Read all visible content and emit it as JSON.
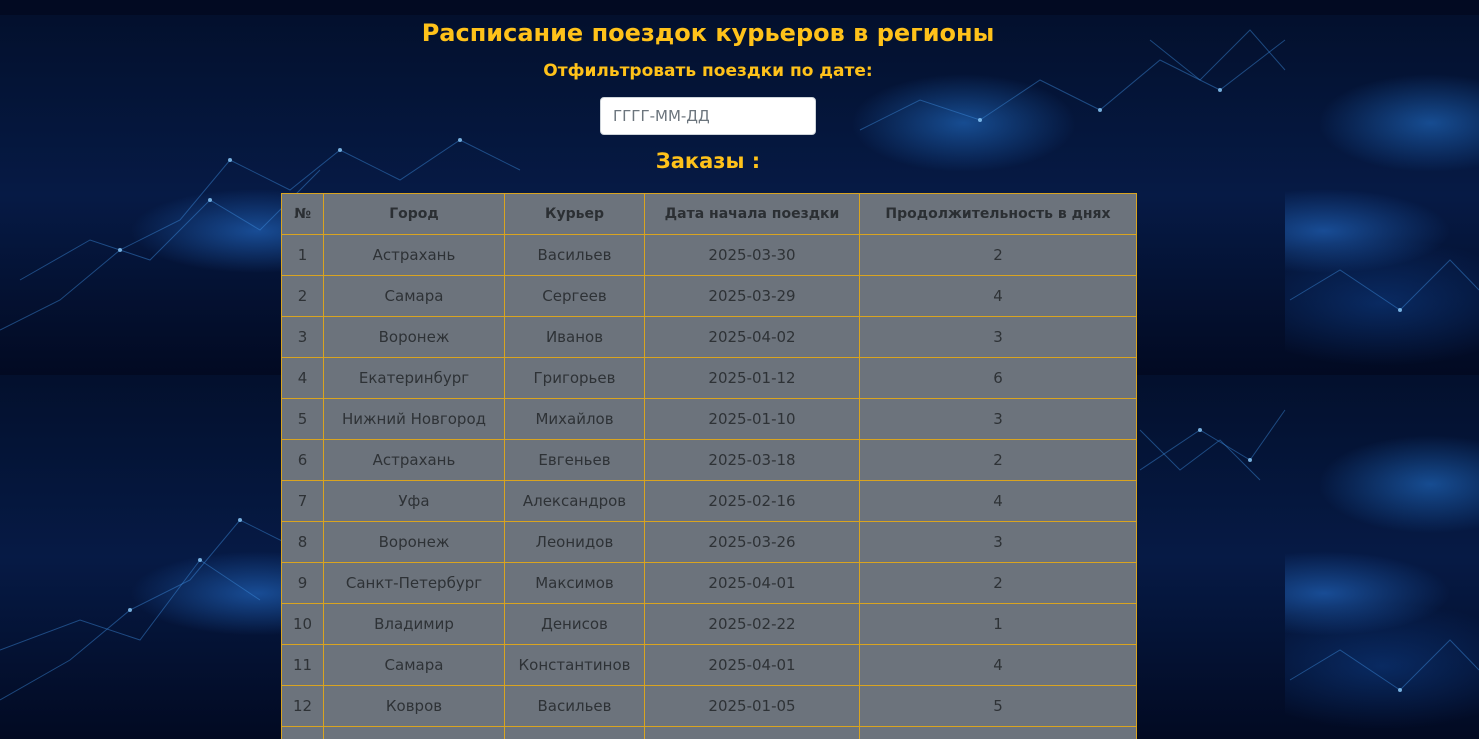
{
  "page": {
    "title": "Расписание поездок курьеров в регионы",
    "filter_label": "Отфильтровать поездки по дате:",
    "date_input": {
      "placeholder": "ГГГГ-ММ-ДД",
      "value": ""
    },
    "orders_heading": "Заказы :"
  },
  "colors": {
    "accent": "#ffc21a",
    "table_bg": "#6c737c",
    "table_border": "#d9a420",
    "background": "#04102e"
  },
  "table": {
    "columns": [
      "№",
      "Город",
      "Курьер",
      "Дата начала поездки",
      "Продолжительность в днях"
    ],
    "rows": [
      [
        "1",
        "Астрахань",
        "Васильев",
        "2025-03-30",
        "2"
      ],
      [
        "2",
        "Самара",
        "Сергеев",
        "2025-03-29",
        "4"
      ],
      [
        "3",
        "Воронеж",
        "Иванов",
        "2025-04-02",
        "3"
      ],
      [
        "4",
        "Екатеринбург",
        "Григорьев",
        "2025-01-12",
        "6"
      ],
      [
        "5",
        "Нижний Новгород",
        "Михайлов",
        "2025-01-10",
        "3"
      ],
      [
        "6",
        "Астрахань",
        "Евгеньев",
        "2025-03-18",
        "2"
      ],
      [
        "7",
        "Уфа",
        "Александров",
        "2025-02-16",
        "4"
      ],
      [
        "8",
        "Воронеж",
        "Леонидов",
        "2025-03-26",
        "3"
      ],
      [
        "9",
        "Санкт-Петербург",
        "Максимов",
        "2025-04-01",
        "2"
      ],
      [
        "10",
        "Владимир",
        "Денисов",
        "2025-02-22",
        "1"
      ],
      [
        "11",
        "Самара",
        "Константинов",
        "2025-04-01",
        "4"
      ],
      [
        "12",
        "Ковров",
        "Васильев",
        "2025-01-05",
        "5"
      ],
      [
        "",
        "",
        "",
        "",
        ""
      ]
    ]
  }
}
